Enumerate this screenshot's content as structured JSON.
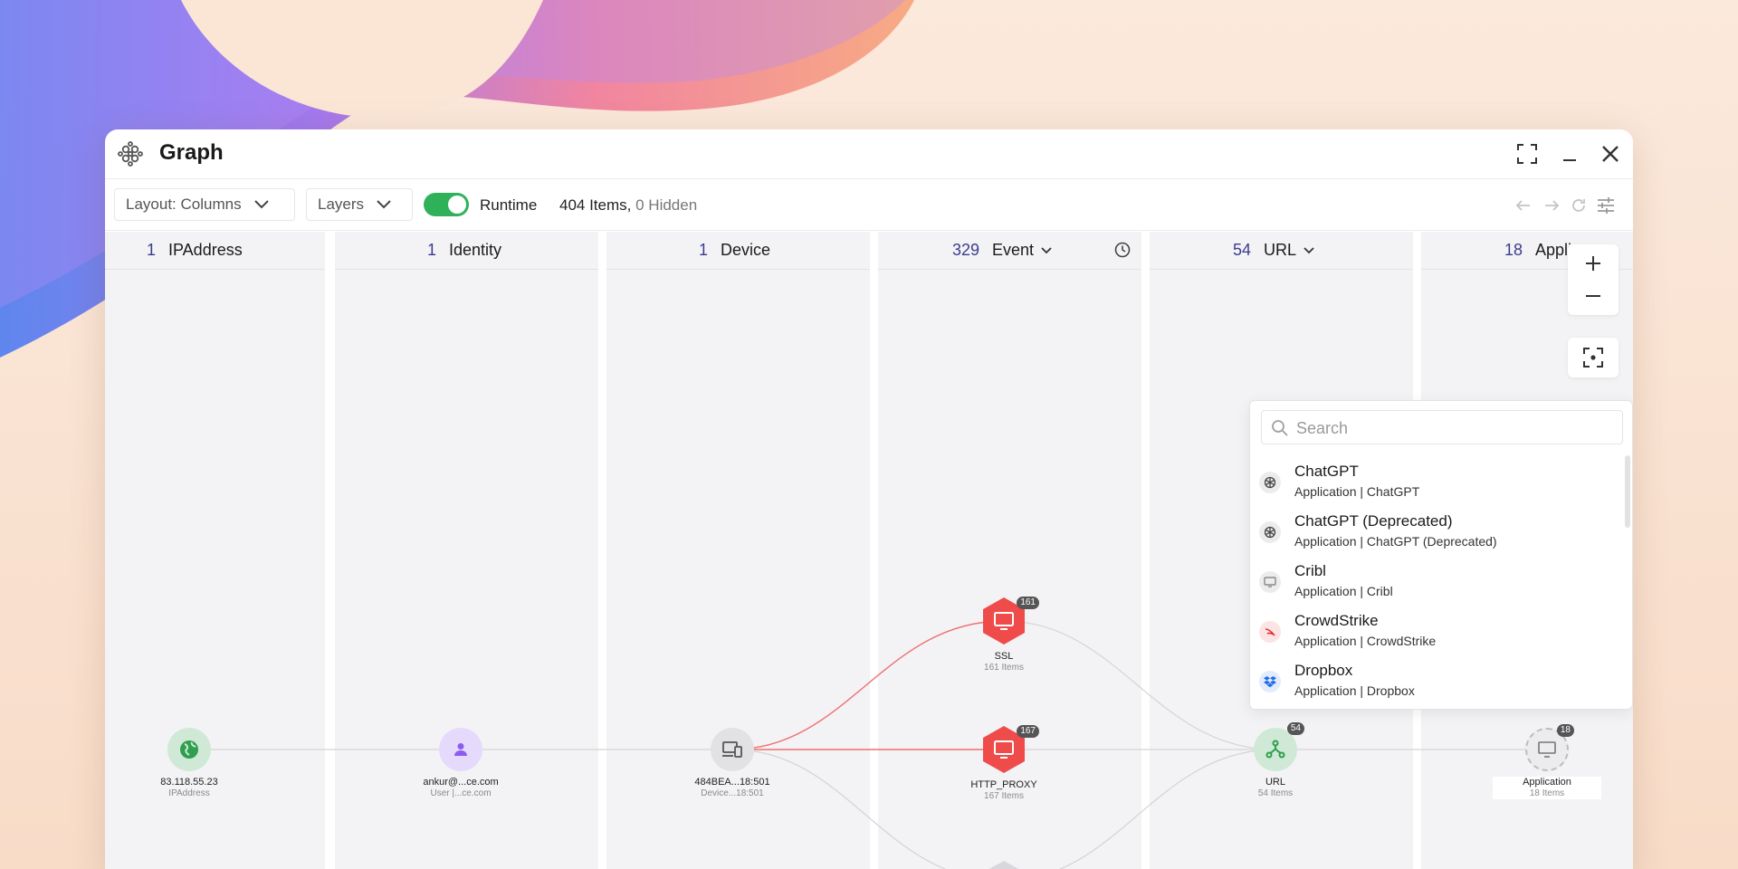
{
  "window": {
    "title": "Graph",
    "app_icon": "graph-app-icon"
  },
  "toolbar": {
    "layout_label": "Layout: Columns",
    "layers_label": "Layers",
    "runtime_label": "Runtime",
    "runtime_enabled": true,
    "items_count": "404 Items,",
    "hidden_count": "0 Hidden"
  },
  "columns": [
    {
      "count": "1",
      "name": "IPAddress"
    },
    {
      "count": "1",
      "name": "Identity"
    },
    {
      "count": "1",
      "name": "Device"
    },
    {
      "count": "329",
      "name": "Event"
    },
    {
      "count": "54",
      "name": "URL"
    },
    {
      "count": "18",
      "name": "Applica"
    }
  ],
  "nodes": {
    "ip": {
      "label": "83.118.55.23",
      "sub": "IPAddress"
    },
    "identity": {
      "label": "ankur@...ce.com",
      "sub": "User |...ce.com"
    },
    "device": {
      "label": "484BEA...18:501",
      "sub": "Device...18:501"
    },
    "ssl": {
      "label": "SSL",
      "sub": "161 Items",
      "badge": "161"
    },
    "http": {
      "label": "HTTP_PROXY",
      "sub": "167 Items",
      "badge": "167"
    },
    "url": {
      "label": "URL",
      "sub": "54 Items",
      "badge": "54"
    },
    "app": {
      "label": "Application",
      "sub": "18 Items",
      "badge": "18"
    }
  },
  "search": {
    "placeholder": "Search",
    "items": [
      {
        "title": "ChatGPT",
        "sub": "Application | ChatGPT",
        "icon": "openai-icon"
      },
      {
        "title": "ChatGPT (Deprecated)",
        "sub": "Application | ChatGPT (Deprecated)",
        "icon": "openai-icon"
      },
      {
        "title": "Cribl",
        "sub": "Application | Cribl",
        "icon": "monitor-icon"
      },
      {
        "title": "CrowdStrike",
        "sub": "Application | CrowdStrike",
        "icon": "crowdstrike-icon"
      },
      {
        "title": "Dropbox",
        "sub": "Application | Dropbox",
        "icon": "dropbox-icon"
      }
    ]
  },
  "colors": {
    "accent_green": "#2fb15a",
    "event_red": "#f04b4b",
    "count_blue": "#3b3b8f"
  }
}
